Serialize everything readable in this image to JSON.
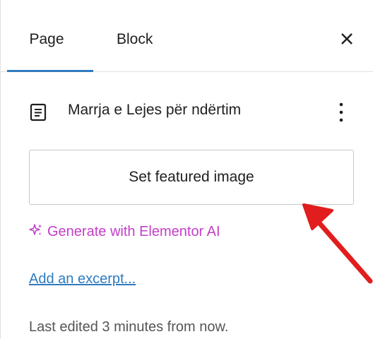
{
  "tabs": [
    {
      "label": "Page",
      "active": true
    },
    {
      "label": "Block",
      "active": false
    }
  ],
  "close_icon": "close-icon",
  "document": {
    "icon": "document-icon",
    "title": "Marrja e Lejes për ndërtim",
    "menu_icon": "more-vertical-icon"
  },
  "featured_image": {
    "label": "Set featured image"
  },
  "ai": {
    "icon": "sparkle-icon",
    "label": "Generate with Elementor AI",
    "color": "#c33ec8"
  },
  "excerpt": {
    "label": "Add an excerpt..."
  },
  "status": {
    "last_edited": "Last edited 3 minutes from now."
  },
  "colors": {
    "accent": "#2e7bbf",
    "annotation_arrow": "#e11d1d"
  }
}
